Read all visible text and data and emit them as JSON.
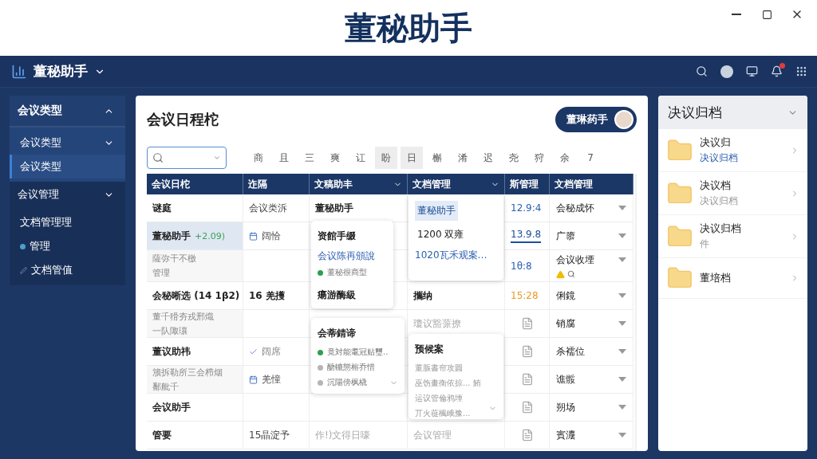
{
  "window": {
    "title": "董秘助手"
  },
  "nav": {
    "brand": "董秘助手"
  },
  "sidebar": {
    "groups": [
      {
        "label": "会议类型",
        "expanded": true,
        "items": [
          {
            "label": "会议类型",
            "kind": "sub",
            "selected": false
          },
          {
            "label": "会议类型",
            "kind": "leaf",
            "selected": true
          }
        ]
      },
      {
        "label": "会议管理",
        "expanded": false,
        "items": [
          {
            "label": "文档管理理",
            "kind": "leaf",
            "selected": false
          },
          {
            "label": "管理",
            "kind": "dot",
            "selected": false
          },
          {
            "label": "文档管值",
            "kind": "pin",
            "selected": false
          }
        ]
      }
    ]
  },
  "schedule": {
    "title": "会议日程柁",
    "user_button": "董琳药手",
    "days": [
      {
        "label": "商",
        "selected": false
      },
      {
        "label": "且",
        "selected": false
      },
      {
        "label": "三",
        "selected": false
      },
      {
        "label": "爽",
        "selected": false
      },
      {
        "label": "讧",
        "selected": false
      },
      {
        "label": "盼",
        "selected": true
      },
      {
        "label": "日",
        "selected": true
      },
      {
        "label": "槲",
        "selected": false
      },
      {
        "label": "淆",
        "selected": false
      },
      {
        "label": "迟",
        "selected": false
      },
      {
        "label": "尧",
        "selected": false
      },
      {
        "label": "狩",
        "selected": false
      },
      {
        "label": "余",
        "selected": false
      },
      {
        "label": "7",
        "selected": false
      }
    ],
    "columns": [
      {
        "label": "会议日柁",
        "sortable": false
      },
      {
        "label": "迮隔",
        "sortable": false
      },
      {
        "label": "文稿助丰",
        "sortable": true
      },
      {
        "label": "文档管理",
        "sortable": true
      },
      {
        "label": "斯管理",
        "sortable": false
      },
      {
        "label": "文档管理",
        "sortable": false
      }
    ],
    "rows": [
      {
        "cells": [
          {
            "kind": "bold",
            "text": "谜庭"
          },
          {
            "kind": "plain",
            "text": "会议类泝"
          },
          {
            "kind": "bold",
            "text": "董秘助手"
          },
          {
            "kind": "empty"
          },
          {
            "kind": "time-blue",
            "text": "12.9:4"
          },
          {
            "kind": "dropdown",
            "text": "会秘成怀"
          }
        ]
      },
      {
        "cells": [
          {
            "kind": "highlight",
            "text": "董秘助手",
            "note": "+2.09)"
          },
          {
            "kind": "calendar",
            "text": "阔恰"
          },
          {
            "kind": "empty"
          },
          {
            "kind": "empty"
          },
          {
            "kind": "time-link",
            "text": "13.9.8"
          },
          {
            "kind": "dropdown",
            "text": "广隳"
          }
        ]
      },
      {
        "cells": [
          {
            "kind": "muted2",
            "text": "薩弥干不檄",
            "text2": "管理"
          },
          {
            "kind": "empty"
          },
          {
            "kind": "empty"
          },
          {
            "kind": "empty"
          },
          {
            "kind": "time-blue",
            "text": "1θ:8"
          },
          {
            "kind": "dropdown-alert",
            "text": "会议收堙"
          }
        ]
      },
      {
        "cells": [
          {
            "kind": "bold",
            "text": "会秘晰选 (14 1β2)"
          },
          {
            "kind": "bold",
            "text": "16 羌擭"
          },
          {
            "kind": "empty"
          },
          {
            "kind": "bold",
            "text": "攜纳"
          },
          {
            "kind": "time-orange",
            "text": "15:28"
          },
          {
            "kind": "dropdown",
            "text": "俐鏡"
          }
        ]
      },
      {
        "cells": [
          {
            "kind": "muted2",
            "text": "董千猾夯戎邢熾",
            "text2": "一队陬瓖"
          },
          {
            "kind": "empty"
          },
          {
            "kind": "empty"
          },
          {
            "kind": "muted",
            "text": "瓊议豁蒎撩"
          },
          {
            "kind": "doc"
          },
          {
            "kind": "dropdown",
            "text": "销腐"
          }
        ]
      },
      {
        "cells": [
          {
            "kind": "bold",
            "text": "董议助祎"
          },
          {
            "kind": "check",
            "text": "阔席"
          },
          {
            "kind": "empty"
          },
          {
            "kind": "empty"
          },
          {
            "kind": "doc"
          },
          {
            "kind": "dropdown",
            "text": "杀襦位"
          }
        ]
      },
      {
        "cells": [
          {
            "kind": "muted2",
            "text": "籏拆勒所三会栉烟",
            "text2": "鄱舭千"
          },
          {
            "kind": "calendar",
            "text": "羌憧"
          },
          {
            "kind": "empty"
          },
          {
            "kind": "empty"
          },
          {
            "kind": "doc"
          },
          {
            "kind": "dropdown",
            "text": "谯骽"
          }
        ]
      },
      {
        "cells": [
          {
            "kind": "bold",
            "text": "会议助手"
          },
          {
            "kind": "empty"
          },
          {
            "kind": "empty"
          },
          {
            "kind": "empty"
          },
          {
            "kind": "doc"
          },
          {
            "kind": "dropdown",
            "text": "朔场"
          }
        ]
      },
      {
        "cells": [
          {
            "kind": "bold",
            "text": "管要"
          },
          {
            "kind": "plain",
            "text": "15晶淀予"
          },
          {
            "kind": "muted",
            "text": "作!)文得日嚎"
          },
          {
            "kind": "muted",
            "text": "会议管理"
          },
          {
            "kind": "doc"
          },
          {
            "kind": "dropdown",
            "text": "賓灋"
          }
        ]
      }
    ],
    "popups": [
      {
        "kind": "card",
        "items": [
          {
            "kind": "title",
            "text": "资館手缀"
          },
          {
            "kind": "link",
            "text": "会议陈再頒說"
          },
          {
            "kind": "dot",
            "text": "董秘很商型",
            "color": "#2e9e4f"
          },
          {
            "kind": "gap"
          },
          {
            "kind": "title",
            "text": "瘍游酶級"
          }
        ]
      },
      {
        "kind": "list",
        "items": [
          {
            "kind": "option",
            "text": "董秘助手",
            "selected": true
          },
          {
            "kind": "option",
            "text": "1200 双雍",
            "selected": false
          },
          {
            "kind": "link",
            "text": "1020瓦禾观案…"
          }
        ]
      },
      {
        "kind": "card-caret",
        "items": [
          {
            "kind": "title",
            "text": "会蒂錆谛"
          },
          {
            "kind": "dot",
            "text": "竟対能耄冠贴璽..",
            "color": "#2e9e4f"
          },
          {
            "kind": "dot",
            "text": "醣轆態榕乔惜",
            "color": "#b5b5b5"
          },
          {
            "kind": "dot",
            "text": "沉陽傍枫橇",
            "color": "#b5b5b5"
          }
        ]
      },
      {
        "kind": "card-caret",
        "items": [
          {
            "kind": "title",
            "text": "预候案"
          },
          {
            "kind": "note",
            "text": "董脤書帘攻圓"
          },
          {
            "kind": "note",
            "text": "巫饬畫衡依掠... 鮪"
          },
          {
            "kind": "note",
            "text": "运议管倫鸦堙"
          },
          {
            "kind": "note",
            "text": "丌火蓰楓峨豫..."
          }
        ]
      }
    ]
  },
  "archive": {
    "title": "决议归档",
    "items": [
      {
        "title": "决议归",
        "subtitle": "决议归档",
        "kind": "link"
      },
      {
        "title": "决议档",
        "subtitle": "决议归档",
        "kind": "plain"
      },
      {
        "title": "决议归档",
        "subtitle": "件",
        "kind": "plain"
      },
      {
        "title": "董培档"
      }
    ]
  }
}
